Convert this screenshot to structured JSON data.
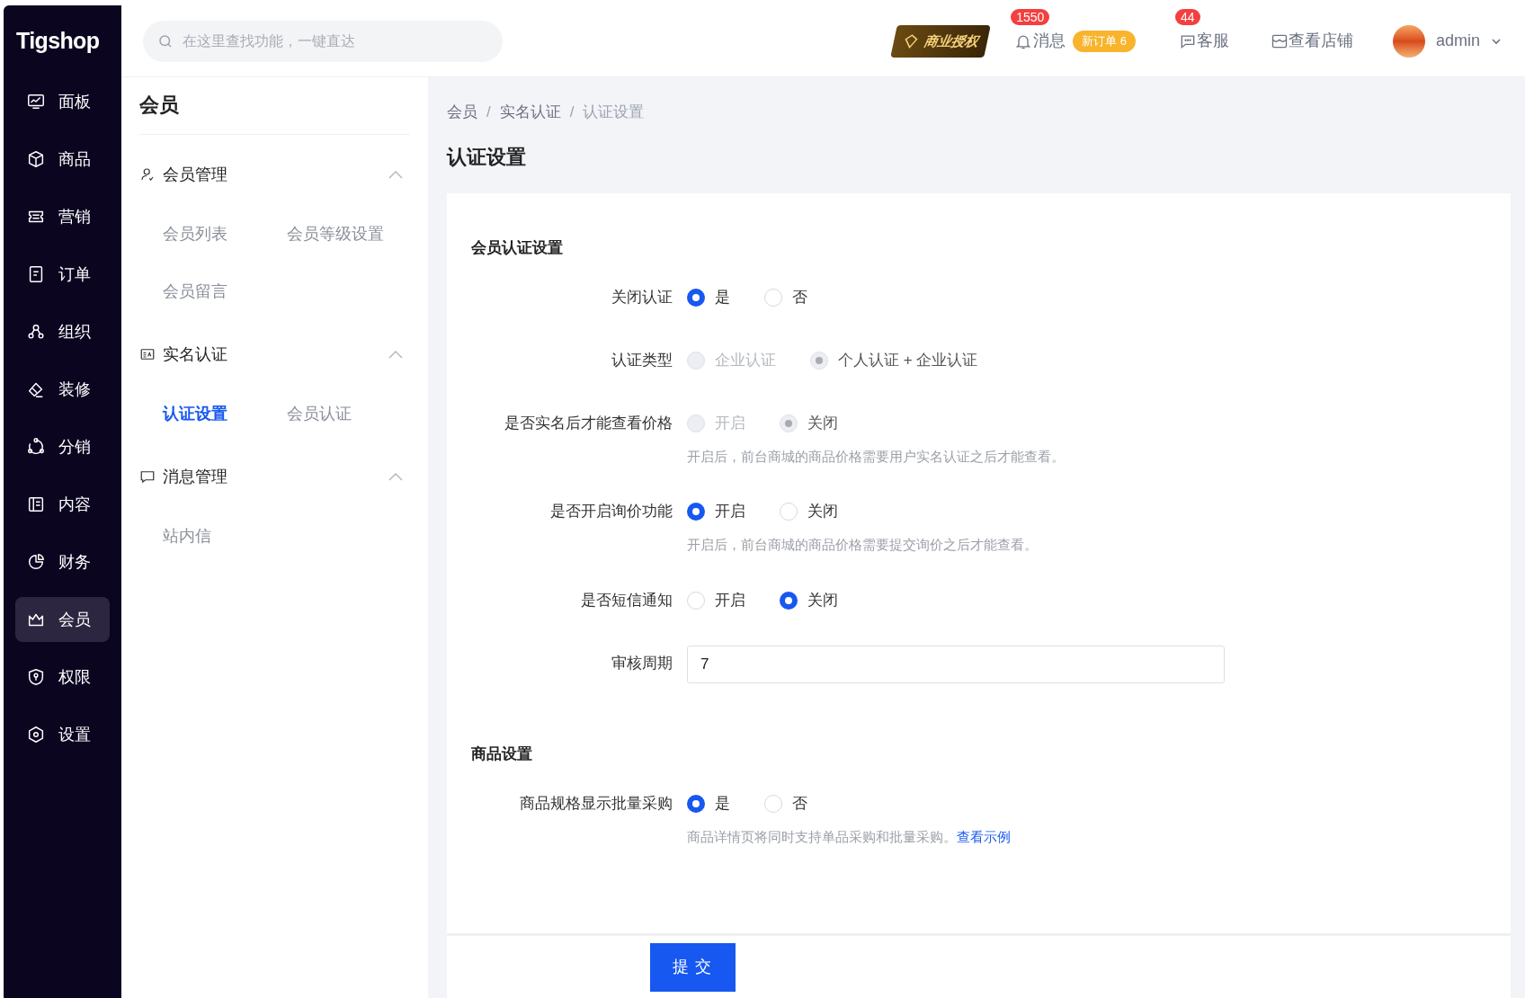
{
  "logo": "Tigshop",
  "search": {
    "placeholder": "在这里查找功能，一键直达"
  },
  "topbar": {
    "license": "商业授权",
    "messages": {
      "label": "消息",
      "count": "1550",
      "badge": "新订单 6"
    },
    "service": {
      "label": "客服",
      "count": "44"
    },
    "store": "查看店铺",
    "user": "admin"
  },
  "nav": [
    {
      "label": "面板",
      "selected": false
    },
    {
      "label": "商品",
      "selected": false
    },
    {
      "label": "营销",
      "selected": false
    },
    {
      "label": "订单",
      "selected": false
    },
    {
      "label": "组织",
      "selected": false
    },
    {
      "label": "装修",
      "selected": false
    },
    {
      "label": "分销",
      "selected": false
    },
    {
      "label": "内容",
      "selected": false
    },
    {
      "label": "财务",
      "selected": false
    },
    {
      "label": "会员",
      "selected": true
    },
    {
      "label": "权限",
      "selected": false
    },
    {
      "label": "设置",
      "selected": false
    }
  ],
  "submenu": {
    "title": "会员",
    "groups": [
      {
        "title": "会员管理",
        "expanded": true,
        "items": [
          {
            "label": "会员列表",
            "selected": false
          },
          {
            "label": "会员等级设置",
            "selected": false
          },
          {
            "label": "会员留言",
            "selected": false
          }
        ]
      },
      {
        "title": "实名认证",
        "expanded": true,
        "items": [
          {
            "label": "认证设置",
            "selected": true
          },
          {
            "label": "会员认证",
            "selected": false
          }
        ]
      },
      {
        "title": "消息管理",
        "expanded": true,
        "items": [
          {
            "label": "站内信",
            "selected": false
          }
        ]
      }
    ]
  },
  "breadcrumb": [
    "会员",
    "实名认证",
    "认证设置"
  ],
  "breadcrumb_separator": "/",
  "page_title": "认证设置",
  "sections": [
    {
      "title": "会员认证设置",
      "fields": [
        {
          "kind": "radio",
          "label": "关闭认证",
          "options": [
            {
              "label": "是",
              "selected": true,
              "disabled": false
            },
            {
              "label": "否",
              "selected": false,
              "disabled": false
            }
          ]
        },
        {
          "kind": "radio",
          "label": "认证类型",
          "options": [
            {
              "label": "企业认证",
              "selected": false,
              "disabled": true
            },
            {
              "label": "个人认证 + 企业认证",
              "selected": true,
              "disabled": true
            }
          ]
        },
        {
          "kind": "radio",
          "label": "是否实名后才能查看价格",
          "options": [
            {
              "label": "开启",
              "selected": false,
              "disabled": true
            },
            {
              "label": "关闭",
              "selected": true,
              "disabled": true
            }
          ],
          "hint": "开启后，前台商城的商品价格需要用户实名认证之后才能查看。"
        },
        {
          "kind": "radio",
          "label": "是否开启询价功能",
          "options": [
            {
              "label": "开启",
              "selected": true,
              "disabled": false
            },
            {
              "label": "关闭",
              "selected": false,
              "disabled": false
            }
          ],
          "hint": "开启后，前台商城的商品价格需要提交询价之后才能查看。"
        },
        {
          "kind": "radio",
          "label": "是否短信通知",
          "options": [
            {
              "label": "开启",
              "selected": false,
              "disabled": false
            },
            {
              "label": "关闭",
              "selected": true,
              "disabled": false
            }
          ]
        },
        {
          "kind": "input",
          "label": "审核周期",
          "value": "7"
        }
      ]
    },
    {
      "title": "商品设置",
      "fields": [
        {
          "kind": "radio",
          "label": "商品规格显示批量采购",
          "options": [
            {
              "label": "是",
              "selected": true,
              "disabled": false
            },
            {
              "label": "否",
              "selected": false,
              "disabled": false
            }
          ],
          "hint": "商品详情页将同时支持单品采购和批量采购。",
          "hint_link": "查看示例"
        }
      ]
    }
  ],
  "submit": "提交"
}
